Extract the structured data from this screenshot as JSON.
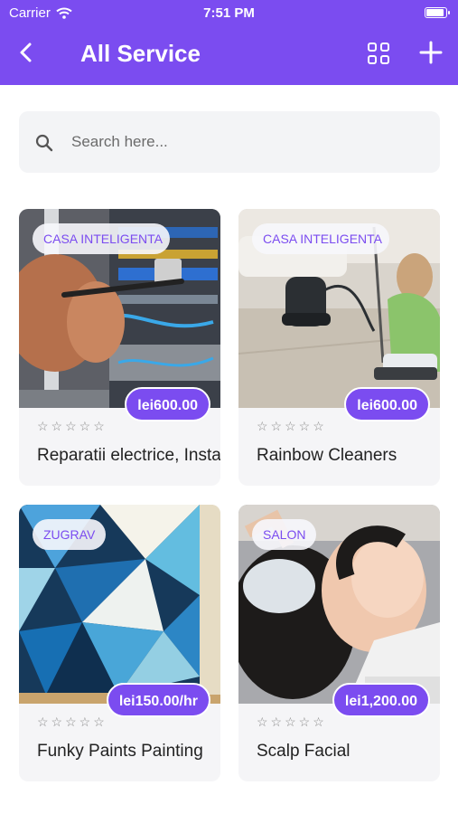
{
  "status_bar": {
    "carrier": "Carrier",
    "time": "7:51 PM"
  },
  "header": {
    "title": "All Service",
    "icons": [
      "back-arrow-icon",
      "grid-view-icon",
      "plus-icon"
    ]
  },
  "search": {
    "placeholder": "Search here..."
  },
  "accent_color": "#7b4cf0",
  "services": [
    {
      "category": "CASA INTELIGENTA",
      "price": "lei600.00",
      "rating": "☆☆☆☆☆",
      "name": "Reparatii electrice, Instalatii"
    },
    {
      "category": "CASA INTELIGENTA",
      "price": "lei600.00",
      "rating": "☆☆☆☆☆",
      "name": "Rainbow Cleaners"
    },
    {
      "category": "ZUGRAV",
      "price": "lei150.00/hr",
      "rating": "☆☆☆☆☆",
      "name": "Funky Paints Painting"
    },
    {
      "category": "SALON",
      "price": "lei1,200.00",
      "rating": "☆☆☆☆☆",
      "name": "Scalp Facial"
    }
  ]
}
